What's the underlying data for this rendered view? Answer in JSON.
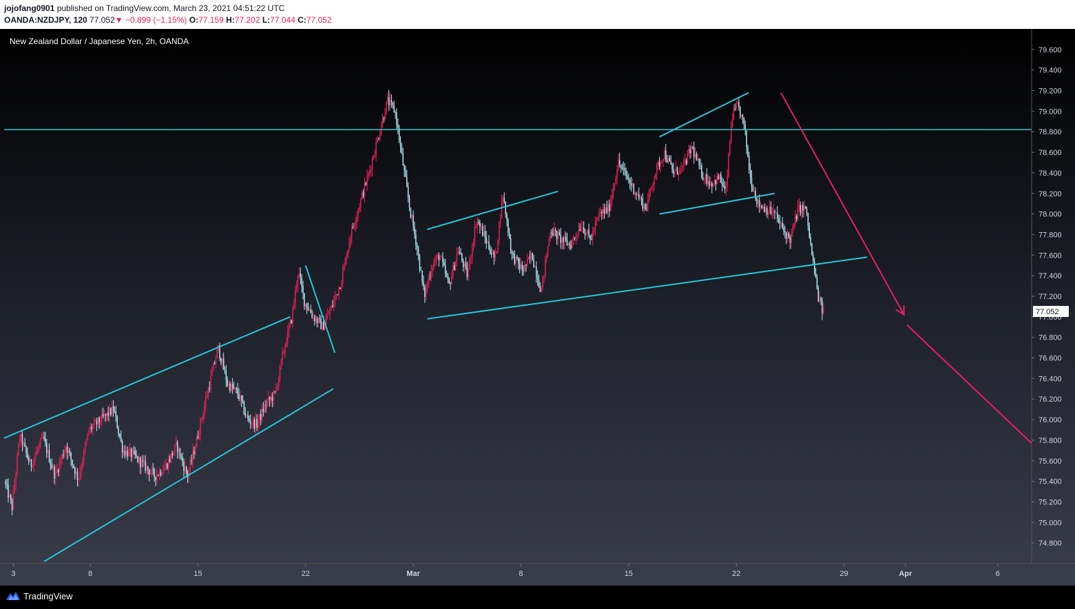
{
  "header": {
    "user": "jojofang0901",
    "published": "published on TradingView.com, March 23, 2021 04:51:22 UTC",
    "symbol": "OANDA:NZDJPY, 120",
    "last": "77.052",
    "arrow": "▼",
    "change": "−0.899 (−1.15%)",
    "o_label": "O:",
    "o": "77.159",
    "h_label": "H:",
    "h": "77.202",
    "l_label": "L:",
    "l": "77.044",
    "c_label": "C:",
    "c": "77.052"
  },
  "footer": {
    "brand": "TradingView",
    "logo_icon": "tradingview-logo-icon"
  },
  "colors": {
    "up": "#ec1f56",
    "down": "#b2ebf2",
    "trendline": "#26c6da",
    "projection": "#e91e63",
    "axis_text": "#d1d4dc",
    "price_label_bg": "#ffffff"
  },
  "chart_data": {
    "type": "candlestick",
    "title": "New Zealand Dollar / Japanese Yen, 2h, OANDA",
    "y_ticks": [
      "79.600",
      "79.400",
      "79.200",
      "79.000",
      "78.800",
      "78.600",
      "78.400",
      "78.200",
      "78.000",
      "77.800",
      "77.600",
      "77.400",
      "77.200",
      "77.000",
      "76.800",
      "76.600",
      "76.400",
      "76.200",
      "76.000",
      "75.800",
      "75.600",
      "75.400",
      "75.200",
      "75.000",
      "74.800"
    ],
    "ylim": [
      74.6,
      79.8
    ],
    "x_ticks": [
      "3",
      "8",
      "15",
      "22",
      "Mar",
      "8",
      "15",
      "22",
      "29",
      "Apr",
      "6"
    ],
    "x_tick_days": [
      3,
      8,
      15,
      22,
      29,
      36,
      43,
      50,
      57,
      61,
      67
    ],
    "xlim_days": [
      2.4,
      69.2
    ],
    "last_price_label": "77.052",
    "price_path": [
      [
        2.5,
        75.4
      ],
      [
        3.0,
        75.15
      ],
      [
        3.5,
        75.85
      ],
      [
        4.2,
        75.55
      ],
      [
        5.0,
        75.82
      ],
      [
        5.8,
        75.45
      ],
      [
        6.5,
        75.75
      ],
      [
        7.3,
        75.42
      ],
      [
        8.0,
        75.9
      ],
      [
        8.8,
        76.0
      ],
      [
        9.6,
        76.1
      ],
      [
        10.2,
        75.7
      ],
      [
        10.9,
        75.65
      ],
      [
        11.6,
        75.55
      ],
      [
        12.3,
        75.45
      ],
      [
        13.0,
        75.55
      ],
      [
        13.7,
        75.75
      ],
      [
        14.4,
        75.45
      ],
      [
        15.0,
        75.8
      ],
      [
        15.6,
        76.2
      ],
      [
        16.4,
        76.7
      ],
      [
        17.0,
        76.35
      ],
      [
        17.7,
        76.25
      ],
      [
        18.3,
        76.0
      ],
      [
        18.9,
        75.95
      ],
      [
        19.5,
        76.15
      ],
      [
        20.1,
        76.25
      ],
      [
        20.7,
        76.7
      ],
      [
        21.2,
        77.0
      ],
      [
        21.6,
        77.45
      ],
      [
        22.0,
        77.15
      ],
      [
        22.6,
        77.0
      ],
      [
        23.2,
        76.9
      ],
      [
        23.8,
        77.1
      ],
      [
        24.4,
        77.35
      ],
      [
        25.0,
        77.8
      ],
      [
        25.6,
        78.1
      ],
      [
        26.2,
        78.4
      ],
      [
        26.8,
        78.75
      ],
      [
        27.4,
        79.1
      ],
      [
        27.9,
        79.0
      ],
      [
        28.4,
        78.5
      ],
      [
        28.8,
        78.1
      ],
      [
        29.3,
        77.7
      ],
      [
        29.8,
        77.2
      ],
      [
        30.3,
        77.5
      ],
      [
        30.8,
        77.6
      ],
      [
        31.4,
        77.3
      ],
      [
        32.0,
        77.65
      ],
      [
        32.6,
        77.4
      ],
      [
        33.2,
        77.95
      ],
      [
        33.8,
        77.75
      ],
      [
        34.4,
        77.55
      ],
      [
        34.9,
        78.2
      ],
      [
        35.5,
        77.6
      ],
      [
        36.2,
        77.45
      ],
      [
        36.8,
        77.6
      ],
      [
        37.4,
        77.25
      ],
      [
        38.0,
        77.85
      ],
      [
        38.7,
        77.75
      ],
      [
        39.3,
        77.7
      ],
      [
        40.0,
        77.9
      ],
      [
        40.6,
        77.75
      ],
      [
        41.2,
        78.0
      ],
      [
        41.8,
        78.05
      ],
      [
        42.4,
        78.5
      ],
      [
        43.0,
        78.35
      ],
      [
        43.6,
        78.2
      ],
      [
        44.2,
        78.05
      ],
      [
        44.8,
        78.4
      ],
      [
        45.4,
        78.6
      ],
      [
        46.0,
        78.4
      ],
      [
        46.6,
        78.45
      ],
      [
        47.2,
        78.65
      ],
      [
        47.8,
        78.4
      ],
      [
        48.4,
        78.3
      ],
      [
        49.0,
        78.35
      ],
      [
        49.4,
        78.2
      ],
      [
        49.8,
        78.95
      ],
      [
        50.2,
        79.05
      ],
      [
        50.6,
        78.85
      ],
      [
        51.0,
        78.35
      ],
      [
        51.5,
        78.1
      ],
      [
        52.0,
        78.05
      ],
      [
        52.6,
        78.0
      ],
      [
        53.1,
        77.85
      ],
      [
        53.6,
        77.75
      ],
      [
        54.1,
        78.05
      ],
      [
        54.6,
        78.05
      ],
      [
        55.0,
        77.6
      ],
      [
        55.4,
        77.2
      ],
      [
        55.7,
        77.052
      ]
    ],
    "annotations": {
      "horizontal_level": 78.82,
      "trendlines_days": [
        [
          [
            2.4,
            75.82
          ],
          [
            21.0,
            77.0
          ]
        ],
        [
          [
            5.0,
            74.62
          ],
          [
            23.8,
            76.3
          ]
        ],
        [
          [
            22.0,
            77.5
          ],
          [
            23.9,
            76.65
          ]
        ],
        [
          [
            29.9,
            77.85
          ],
          [
            38.4,
            78.22
          ]
        ],
        [
          [
            29.9,
            76.98
          ],
          [
            58.5,
            77.58
          ]
        ],
        [
          [
            45.0,
            78.0
          ],
          [
            52.5,
            78.2
          ]
        ],
        [
          [
            45.0,
            78.75
          ],
          [
            50.8,
            79.18
          ]
        ]
      ],
      "projection_arrow_days": [
        [
          [
            52.9,
            79.18
          ],
          [
            60.9,
            77.02
          ]
        ],
        [
          [
            61.1,
            76.92
          ],
          [
            69.2,
            75.77
          ]
        ]
      ]
    },
    "grid": false,
    "legend": "none"
  }
}
